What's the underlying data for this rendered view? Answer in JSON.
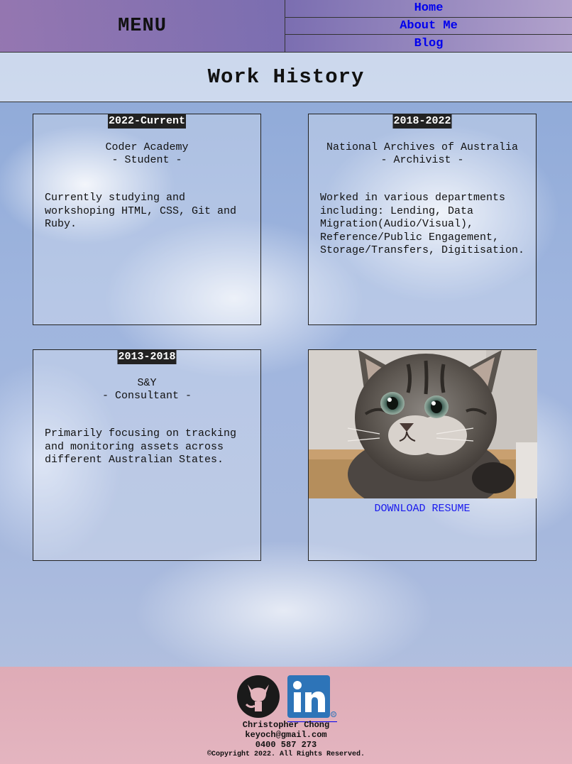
{
  "header": {
    "menu_title": "MENU",
    "nav": [
      {
        "label": "Home"
      },
      {
        "label": "About Me"
      },
      {
        "label": "Blog"
      }
    ]
  },
  "page": {
    "title": "Work History"
  },
  "jobs": [
    {
      "date": "2022-Current",
      "org": "Coder Academy",
      "role": "- Student -",
      "desc": "Currently studying and workshoping HTML, CSS, Git and Ruby."
    },
    {
      "date": "2018-2022",
      "org": "National Archives of Australia",
      "role": "- Archivist -",
      "desc": "Worked in various departments including: Lending, Data Migration(Audio/Visual), Reference/Public Engagement, Storage/Transfers, Digitisation."
    },
    {
      "date": "2013-2018",
      "org": "S&Y",
      "role": "- Consultant -",
      "desc": "Primarily focusing on tracking and monitoring assets across different Australian States."
    }
  ],
  "resume": {
    "photo_icon": "kitten-photo",
    "link_label": "DOWNLOAD RESUME"
  },
  "footer": {
    "github_icon": "github-icon",
    "linkedin_icon": "linkedin-icon",
    "name": "Christopher Chong",
    "email": "keyoch@gmail.com",
    "phone": "0400 587 273",
    "copyright": "©Copyright 2022. All Rights Reserved."
  },
  "colors": {
    "link": "#0000ee",
    "linkedin": "#2d74b8",
    "date_badge_bg": "#222222"
  }
}
